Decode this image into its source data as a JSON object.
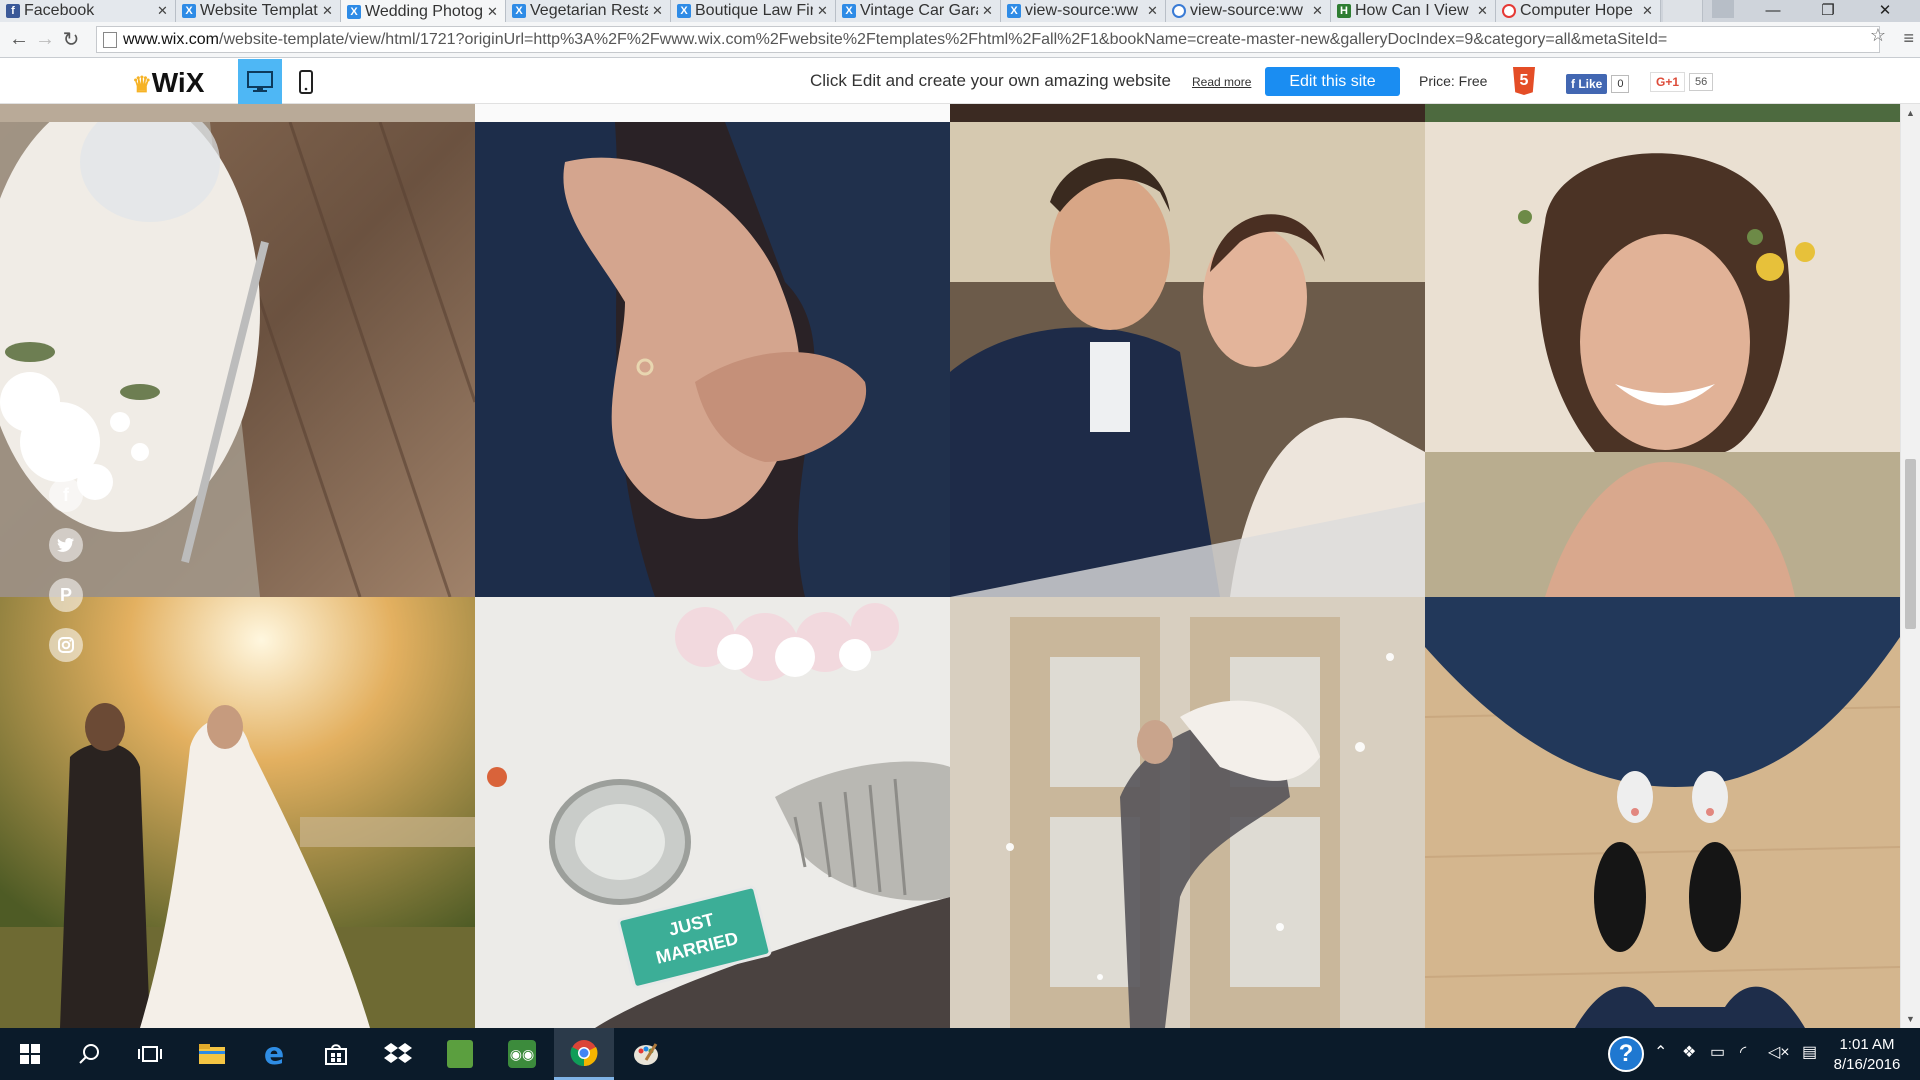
{
  "tabs": [
    {
      "title": "Facebook",
      "favicon": "facebook-icon",
      "active": false
    },
    {
      "title": "Website Templat",
      "favicon": "wix-icon",
      "active": false
    },
    {
      "title": "Wedding Photog",
      "favicon": "wix-icon",
      "active": true
    },
    {
      "title": "Vegetarian Resta",
      "favicon": "wix-icon",
      "active": false
    },
    {
      "title": "Boutique Law Fir",
      "favicon": "wix-icon",
      "active": false
    },
    {
      "title": "Vintage Car Gara",
      "favicon": "wix-icon",
      "active": false
    },
    {
      "title": "view-source:ww",
      "favicon": "wix-icon",
      "active": false
    },
    {
      "title": "view-source:ww",
      "favicon": "chrome-icon",
      "active": false
    },
    {
      "title": "How Can I View",
      "favicon": "computerhope-icon",
      "active": false
    },
    {
      "title": "Computer Hope",
      "favicon": "google-icon",
      "active": false
    }
  ],
  "addressbar": {
    "host": "www.wix.com",
    "path": "/website-template/view/html/1721?originUrl=http%3A%2F%2Fwww.wix.com%2Fwebsite%2Ftemplates%2Fhtml%2Fall%2F1&bookName=create-master-new&galleryDocIndex=9&category=all&metaSiteId="
  },
  "wixbar": {
    "logo": "WiX",
    "promo": "Click Edit and create your own amazing website",
    "read_more": "Read more",
    "edit_button": "Edit this site",
    "price": "Price: Free",
    "html5": "5",
    "fb_like": "Like",
    "fb_count": "0",
    "gplus": "G+1",
    "gplus_count": "56"
  },
  "gallery": {
    "tiles": [
      {
        "name": "table-setting-photo",
        "colors": [
          "#6b5443",
          "#a88d76",
          "#e9e4dc"
        ]
      },
      {
        "name": "engagement-ring-hands-photo",
        "colors": [
          "#1c2b45",
          "#b88f78",
          "#2b1f22"
        ]
      },
      {
        "name": "couple-in-car-photo",
        "colors": [
          "#2a3a55",
          "#d9c9b4",
          "#6a5a4a"
        ]
      },
      {
        "name": "smiling-bride-photo",
        "colors": [
          "#e6d8c6",
          "#b08a6d",
          "#8f6f55"
        ]
      },
      {
        "name": "couple-sunset-field-photo",
        "colors": [
          "#c9a05a",
          "#5e6a2c",
          "#f3e3c2"
        ]
      },
      {
        "name": "just-married-car-photo",
        "colors": [
          "#eeeeec",
          "#c4c3bf",
          "#4b4341"
        ]
      },
      {
        "name": "couple-dancing-doorway-photo",
        "colors": [
          "#c9bfae",
          "#e2dcd1",
          "#a99a86"
        ]
      },
      {
        "name": "couple-shoes-floor-photo",
        "colors": [
          "#d7b88f",
          "#21324f",
          "#111"
        ]
      }
    ],
    "just_married_text": "JUST MARRIED"
  },
  "social": [
    "facebook-icon",
    "twitter-icon",
    "pinterest-icon",
    "instagram-icon"
  ],
  "taskbar": {
    "time": "1:01 AM",
    "date": "8/16/2016"
  }
}
